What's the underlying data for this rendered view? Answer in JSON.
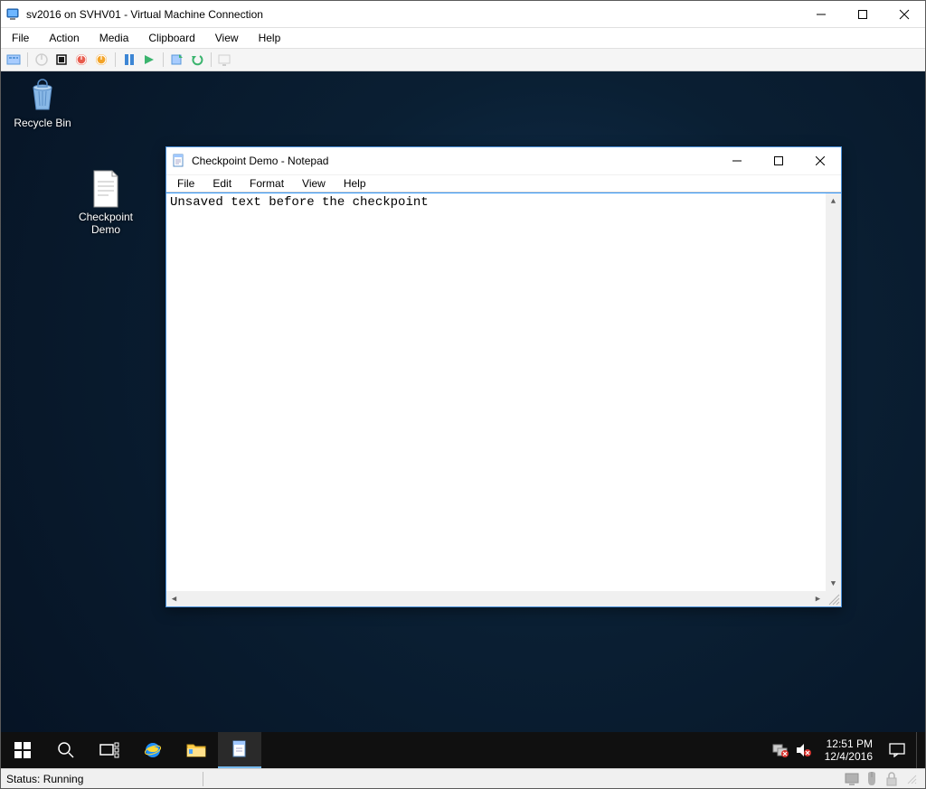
{
  "host": {
    "title": "sv2016 on SVHV01 - Virtual Machine Connection",
    "menu": {
      "file": "File",
      "action": "Action",
      "media": "Media",
      "clipboard": "Clipboard",
      "view": "View",
      "help": "Help"
    },
    "status": "Status: Running"
  },
  "desktop": {
    "recycle_bin": "Recycle Bin",
    "checkpoint_demo": "Checkpoint\nDemo"
  },
  "notepad": {
    "title": "Checkpoint Demo - Notepad",
    "menu": {
      "file": "File",
      "edit": "Edit",
      "format": "Format",
      "view": "View",
      "help": "Help"
    },
    "content": "Unsaved text before the checkpoint"
  },
  "taskbar": {
    "time": "12:51 PM",
    "date": "12/4/2016"
  }
}
